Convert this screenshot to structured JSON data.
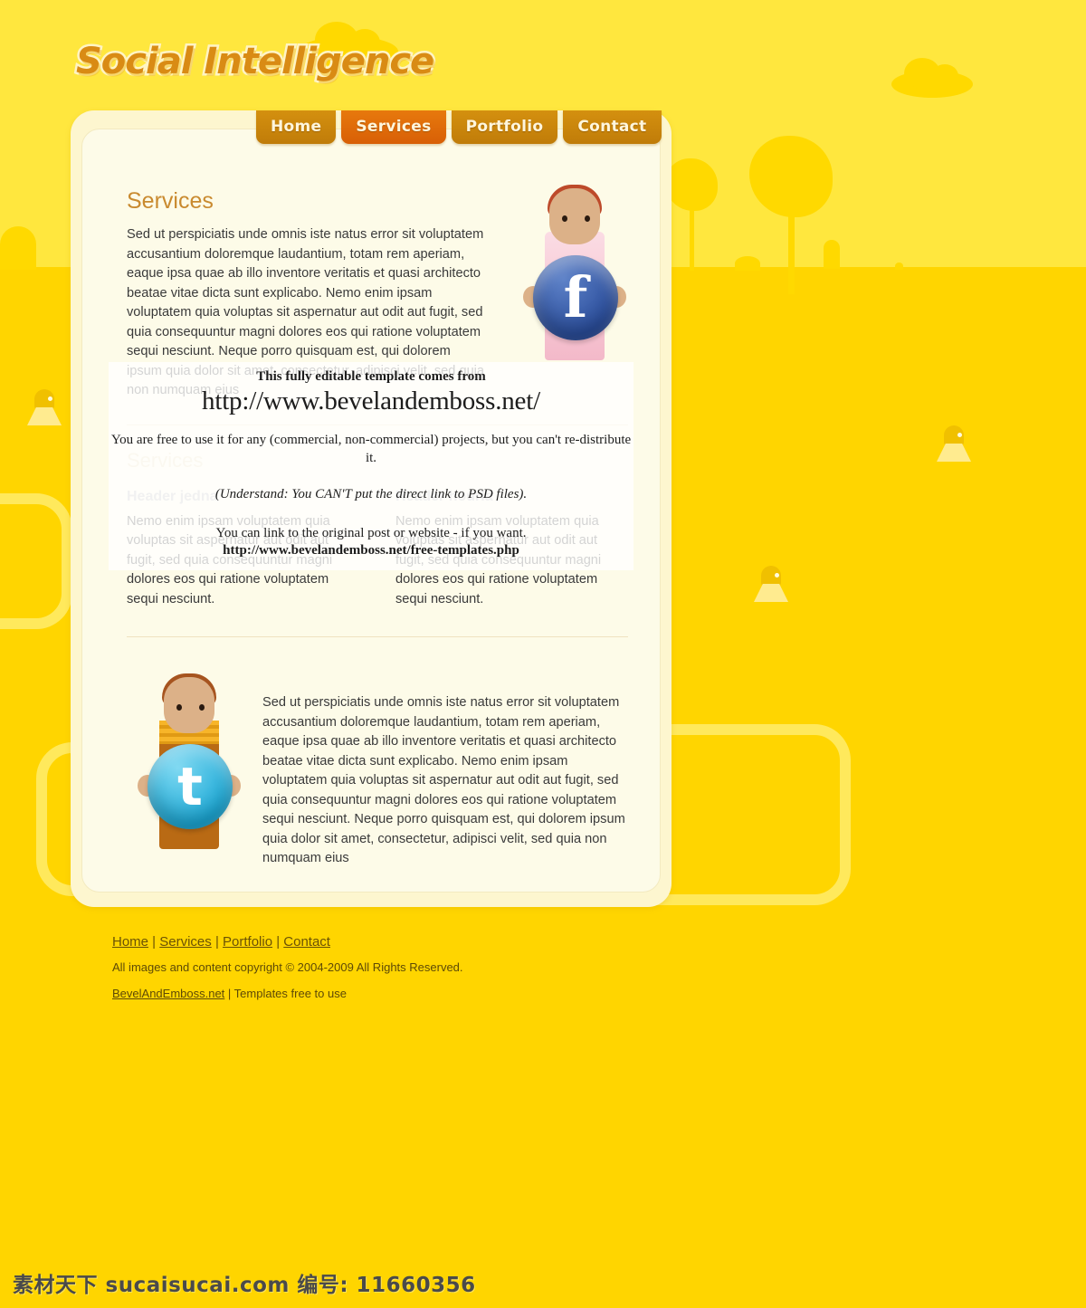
{
  "site": {
    "logo": "Social Intelligence"
  },
  "nav": {
    "items": [
      {
        "label": "Home",
        "active": false
      },
      {
        "label": "Services",
        "active": true
      },
      {
        "label": "Portfolio",
        "active": false
      },
      {
        "label": "Contact",
        "active": false
      }
    ]
  },
  "main": {
    "heading": "Services",
    "intro": "Sed ut perspiciatis unde omnis iste natus error sit voluptatem accusantium doloremque laudantium, totam rem aperiam, eaque ipsa quae ab illo inventore veritatis et quasi architecto beatae vitae dicta sunt explicabo. Nemo enim ipsam voluptatem quia voluptas sit aspernatur aut odit aut fugit, sed quia consequuntur magni dolores eos qui ratione voluptatem sequi nesciunt. Neque porro quisquam est, qui dolorem ipsum quia dolor sit amet, consectetur, adipisci velit, sed quia non numquam eius",
    "subheading": "Services",
    "columns": [
      {
        "header": "Header jedna",
        "text": "Nemo enim ipsam voluptatem quia voluptas sit aspernatur aut odit aut fugit, sed quia consequuntur magni dolores eos qui ratione voluptatem sequi nesciunt."
      },
      {
        "header": "Header hourla",
        "text": "Nemo enim ipsam voluptatem quia voluptas sit aspernatur aut odit aut fugit, sed quia consequuntur magni dolores eos qui ratione voluptatem sequi nesciunt."
      }
    ],
    "media_text": "Sed ut perspiciatis unde omnis iste natus error sit voluptatem accusantium doloremque laudantium, totam rem aperiam, eaque ipsa quae ab illo inventore veritatis et quasi architecto beatae vitae dicta sunt explicabo. Nemo enim ipsam voluptatem quia voluptas sit aspernatur aut odit aut fugit, sed quia consequuntur magni dolores eos qui ratione voluptatem sequi nesciunt. Neque porro quisquam est, qui dolorem ipsum quia dolor sit amet, consectetur, adipisci velit, sed quia non numquam eius",
    "facebook_glyph": "f",
    "twitter_glyph": "t"
  },
  "watermark": {
    "line1": "This fully editable template comes from",
    "line2": "http://www.bevelandemboss.net/",
    "line3": "You are free to use it for any (commercial, non-commercial) projects, but you can't re-distribute it.",
    "line4": "(Understand: You CAN'T put the direct link to PSD files).",
    "line5": "You can link to the original post or website - if you want.",
    "line6": "http://www.bevelandemboss.net/free-templates.php"
  },
  "footer": {
    "links": [
      "Home",
      "Services",
      "Portfolio",
      "Contact"
    ],
    "separator": " | ",
    "copyright": "All images and content copyright © 2004-2009 All Rights Reserved.",
    "credit_link": "BevelAndEmboss.net",
    "credit_rest": " | Templates free to use"
  },
  "stock_bar": {
    "text": "素材天下 sucaisucai.com  编号: 11660356"
  },
  "colors": {
    "sky": "#ffe73e",
    "ground": "#ffd500",
    "panel": "#fdf6cf",
    "panel_inner": "#fdfbe8",
    "nav": "#cf8b10",
    "nav_active": "#e0700a",
    "heading": "#c98a2f",
    "logo": "#d98b14"
  }
}
